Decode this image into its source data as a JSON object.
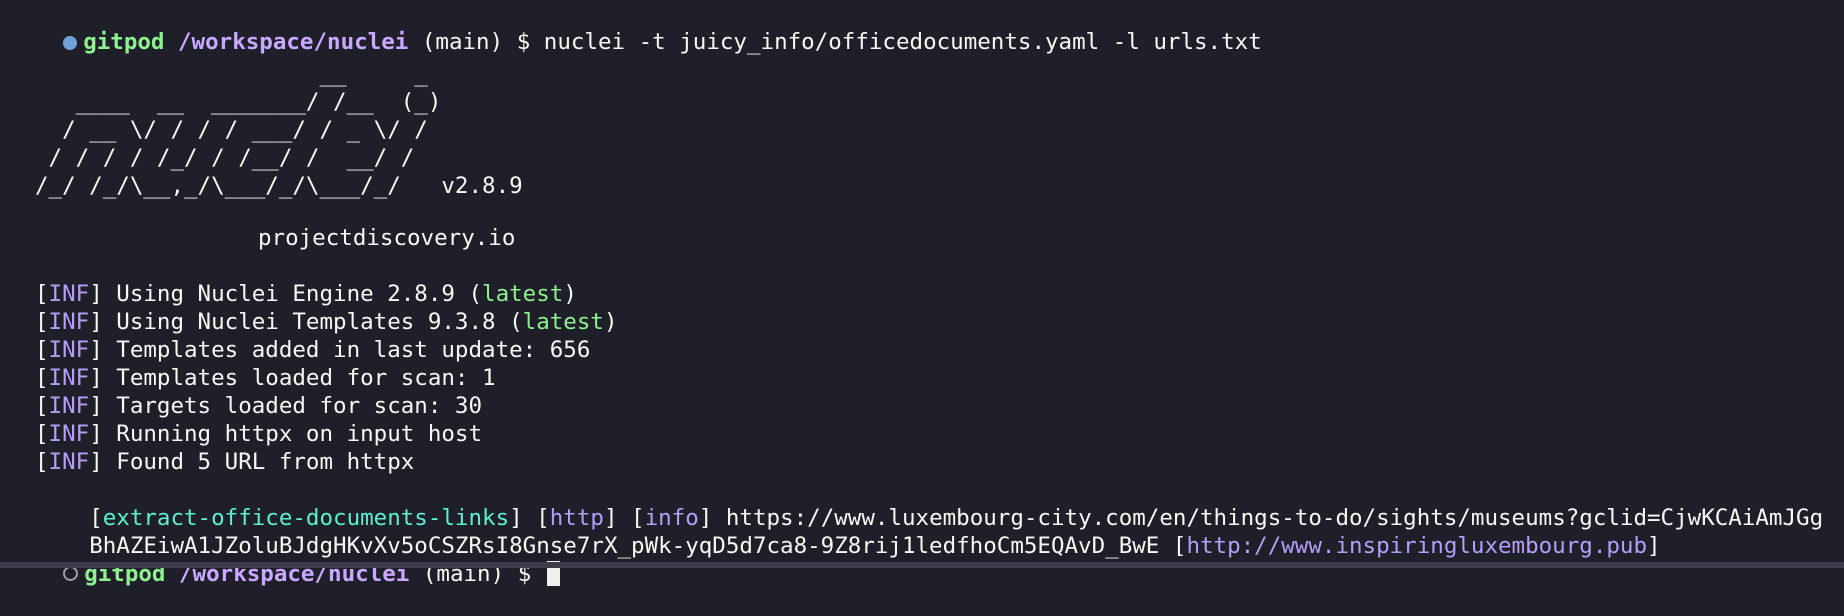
{
  "prompt": {
    "host": "gitpod",
    "path": "/workspace/nuclei",
    "branch": "(main)",
    "symbol": "$"
  },
  "command": "nuclei -t juicy_info/officedocuments.yaml -l urls.txt",
  "banner": {
    "ascii_art": "                     __     _\n   ____  __  _______/ /__  (_)\n  / __ \\/ / / / ___/ / _ \\/ /\n / / / / /_/ / /__/ /  __/ /\n/_/ /_/\\__,_/\\___/_/\\___/_/   v2.8.9",
    "site": "projectdiscovery.io"
  },
  "log_lines": [
    {
      "tag": "INF",
      "pre": " Using Nuclei Engine 2.8.9 (",
      "highlight": "latest",
      "post": ")"
    },
    {
      "tag": "INF",
      "pre": " Using Nuclei Templates 9.3.8 (",
      "highlight": "latest",
      "post": ")"
    },
    {
      "tag": "INF",
      "pre": " Templates added in last update: 656",
      "highlight": "",
      "post": ""
    },
    {
      "tag": "INF",
      "pre": " Templates loaded for scan: 1",
      "highlight": "",
      "post": ""
    },
    {
      "tag": "INF",
      "pre": " Targets loaded for scan: 30",
      "highlight": "",
      "post": ""
    },
    {
      "tag": "INF",
      "pre": " Running httpx on input host",
      "highlight": "",
      "post": ""
    },
    {
      "tag": "INF",
      "pre": " Found 5 URL from httpx",
      "highlight": "",
      "post": ""
    }
  ],
  "result": {
    "template_id": "extract-office-documents-links",
    "protocol": "http",
    "severity": "info",
    "url_part1": "https://www.luxembourg-city.com/en/things-to-do/sights/museums?gclid=CjwKCAiAmJGg",
    "url_part2": "BhAZEiwA1JZoluBJdgHKvXv5oCSZRsI8Gnse7rX_pWk-yqD5d7ca8-9Z8rij1ledfhoCm5EQAvD_BwE",
    "extracted": "http://www.inspiringluxembourg.pub"
  },
  "colors": {
    "background": "#1e1f29",
    "host": "#8ff08f",
    "path": "#c9a8ff",
    "tag": "#b69df8",
    "latest": "#8ff08f",
    "template_id": "#5df0d0"
  }
}
